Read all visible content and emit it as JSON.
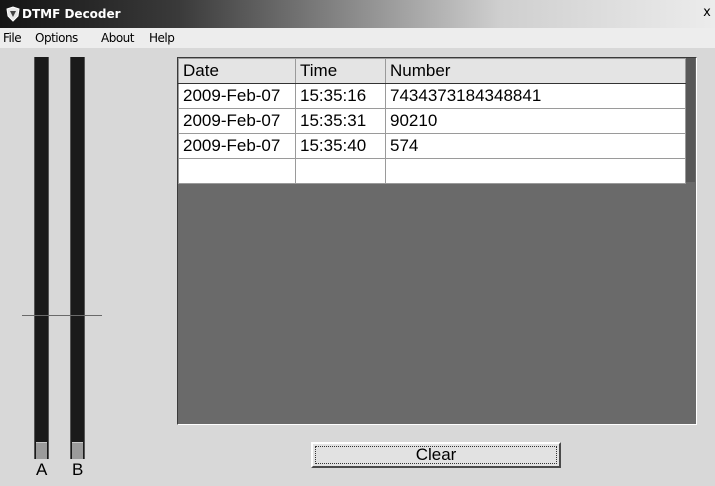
{
  "window": {
    "title": "DTMF Decoder",
    "close_glyph": "x"
  },
  "menu": {
    "items": [
      "File",
      "Options",
      "About",
      "Help"
    ]
  },
  "meters": [
    {
      "label": "A",
      "level": 0.04
    },
    {
      "label": "B",
      "level": 0.04
    }
  ],
  "table": {
    "headers": [
      "Date",
      "Time",
      "Number"
    ],
    "rows": [
      [
        "2009-Feb-07",
        "15:35:16",
        "7434373184348841"
      ],
      [
        "2009-Feb-07",
        "15:35:31",
        "90210"
      ],
      [
        "2009-Feb-07",
        "15:35:40",
        "574"
      ],
      [
        "",
        "",
        ""
      ]
    ]
  },
  "clear_button": {
    "label": "Clear"
  }
}
